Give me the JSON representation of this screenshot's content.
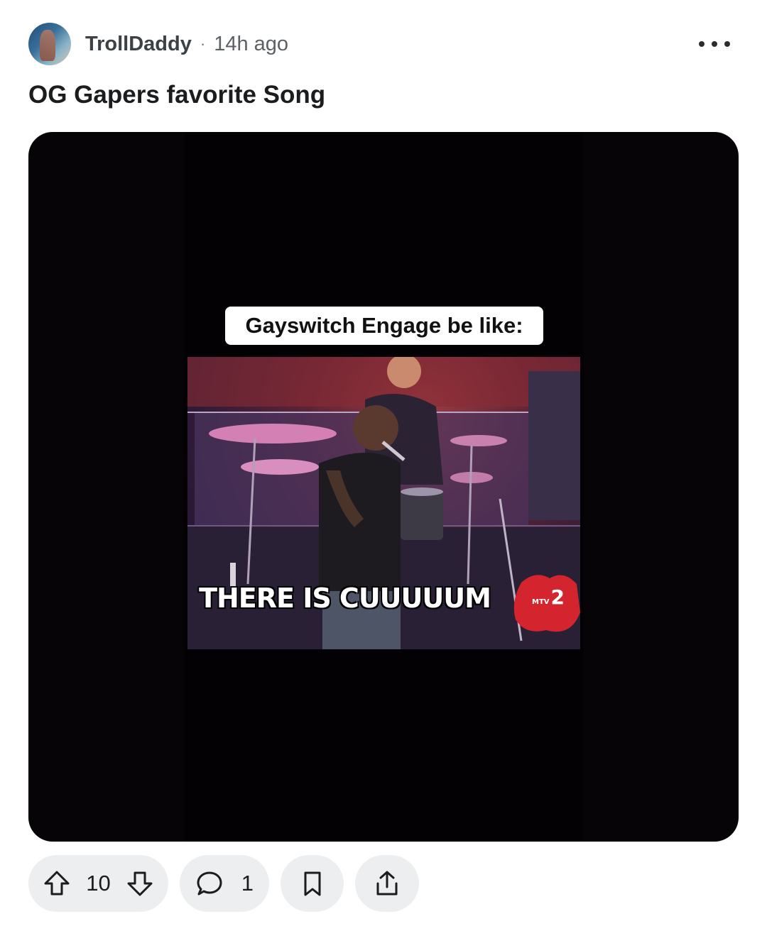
{
  "post": {
    "author": "TrollDaddy",
    "separator": "·",
    "time": "14h ago",
    "title": "OG Gapers favorite Song"
  },
  "media": {
    "caption": "Gayswitch Engage be like:",
    "subtitle": "THERE IS CUUUUUM",
    "watermark_brand": "MTV",
    "watermark_number": "2"
  },
  "actions": {
    "upvotes": "10",
    "comments": "1"
  },
  "icons": {
    "more": "more-horizontal-icon",
    "upvote": "arrow-up-icon",
    "downvote": "arrow-down-icon",
    "comment": "speech-bubble-icon",
    "save": "bookmark-icon",
    "share": "share-icon"
  },
  "colors": {
    "action_pill_bg": "#eceef0",
    "media_bg": "#060406",
    "text_primary": "#1a1c1e",
    "text_secondary": "#5c6166"
  }
}
